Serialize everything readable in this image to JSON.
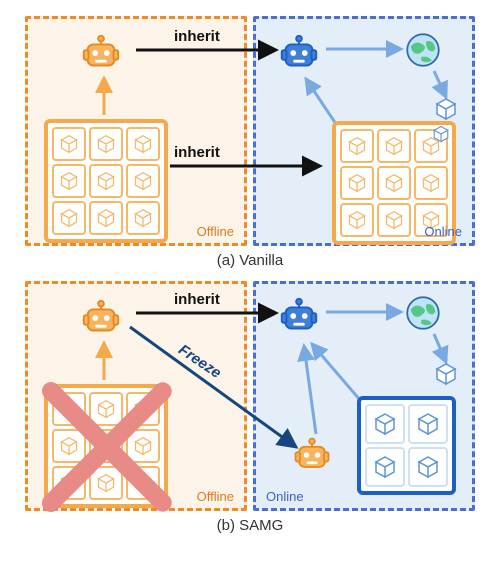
{
  "panels": {
    "vanilla": {
      "caption": "(a) Vanilla",
      "offline_label": "Offline",
      "online_label": "Online",
      "arrow1": "inherit",
      "arrow2": "inherit"
    },
    "samg": {
      "caption": "(b) SAMG",
      "offline_label": "Offline",
      "online_label": "Online",
      "arrow1": "inherit",
      "arrow2": "Freeze"
    }
  },
  "icons": {
    "robot_orange": "robot-icon",
    "robot_blue": "robot-icon",
    "globe": "globe-icon",
    "cube": "cube-icon",
    "dataset": "dataset-grid",
    "cross": "cross-out"
  },
  "colors": {
    "orange": "#f08a24",
    "orange_fill": "#f7b45e",
    "blue": "#4a6fd0",
    "blue_deep": "#1e5fc5",
    "bg_offline": "#fdf4e9",
    "bg_online": "#e3eef8",
    "cross": "#e88a86",
    "black": "#111111"
  },
  "chart_data": {
    "type": "diagram",
    "title": "Comparison of Vanilla vs SAMG offline-to-online transfer",
    "subfigures": [
      {
        "name": "Vanilla",
        "offline": {
          "agent": "policy-robot (orange)",
          "dataset": "large offline dataset (3x3 cubes)",
          "flow": [
            "dataset → agent"
          ]
        },
        "online": {
          "agent": "policy-robot (blue)",
          "env": "environment (globe)",
          "dataset": "replay buffer (3x3 cubes, receives new samples)",
          "flow": [
            "agent → env",
            "env → sample",
            "sample → replay buffer",
            "replay buffer → agent"
          ]
        },
        "cross_phase": [
          {
            "from": "offline.agent",
            "to": "online.agent",
            "label": "inherit"
          },
          {
            "from": "offline.dataset",
            "to": "online.dataset",
            "label": "inherit"
          }
        ]
      },
      {
        "name": "SAMG",
        "offline": {
          "agent": "policy-robot (orange)",
          "dataset": "large offline dataset (3x3 cubes) — discarded (crossed out)",
          "flow": [
            "dataset → agent"
          ]
        },
        "online": {
          "agent": "policy-robot (blue)",
          "helper_agent": "frozen policy-robot (orange)",
          "env": "environment (globe)",
          "dataset": "small replay buffer (2x2 cubes)",
          "flow": [
            "agent → env",
            "env → sample",
            "sample → replay buffer",
            "replay buffer → agent",
            "helper_agent → agent"
          ]
        },
        "cross_phase": [
          {
            "from": "offline.agent",
            "to": "online.agent",
            "label": "inherit"
          },
          {
            "from": "offline.agent",
            "to": "online.helper_agent",
            "label": "Freeze"
          }
        ]
      }
    ]
  }
}
